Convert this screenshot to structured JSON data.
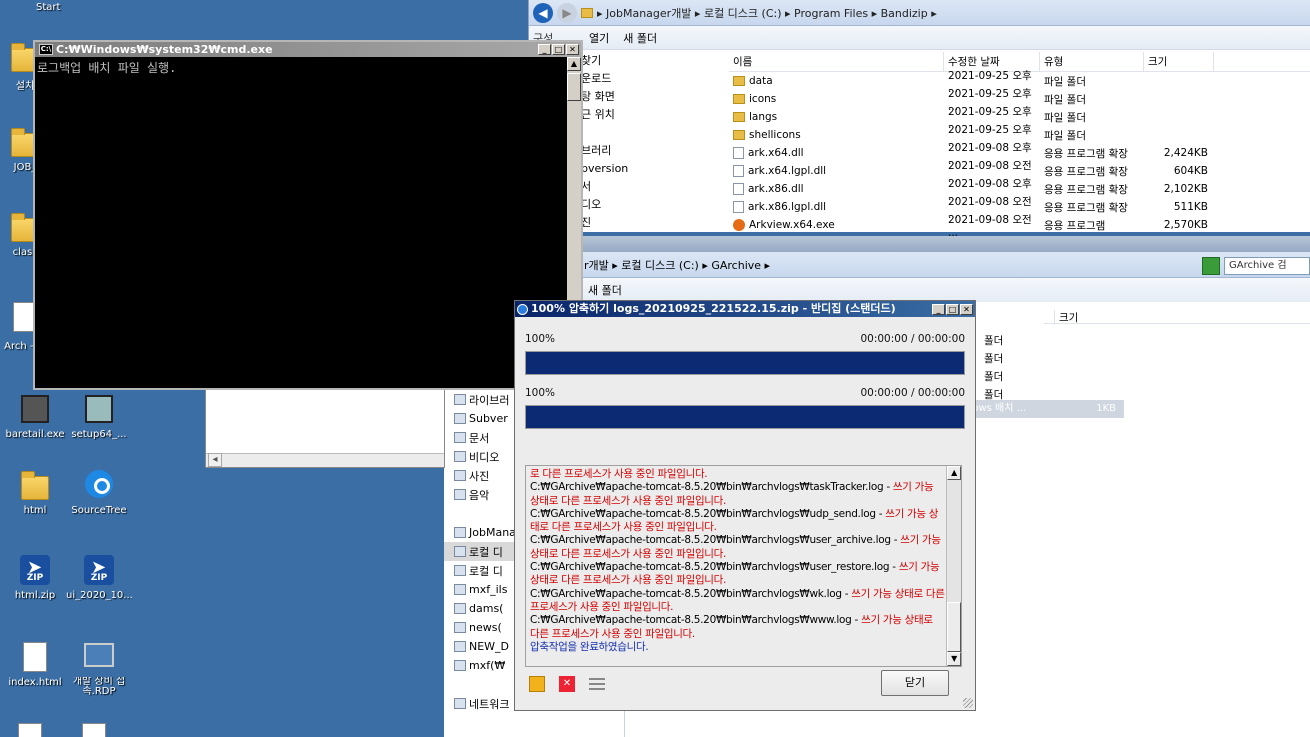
{
  "desktop": {
    "start_label": "Start",
    "icons": [
      {
        "label": "설치"
      },
      {
        "label": "JOB_"
      },
      {
        "label": "class"
      },
      {
        "label": "Arch - 바"
      },
      {
        "label": "baretail.exe"
      },
      {
        "label": "setup64_..."
      },
      {
        "label": "html"
      },
      {
        "label": "SourceTree"
      },
      {
        "label": "html.zip"
      },
      {
        "label": "ui_2020_10..."
      },
      {
        "label": "index.html"
      },
      {
        "label": "개발 장비 접속.RDP"
      }
    ],
    "zip_badge": "ZIP"
  },
  "explorer_top": {
    "breadcrumb": "▸ JobManager개발 ▸ 로컬 디스크 (C:) ▸ Program Files ▸ Bandizip ▸",
    "toolbar": {
      "org": "구성",
      "open": "열기",
      "new_folder": "새 폴더"
    },
    "nav": [
      "찾기",
      "운로드",
      "탕 화면",
      "근 위치",
      "",
      "브러리",
      "bversion",
      "서",
      "디오",
      "진",
      "악"
    ],
    "columns": {
      "name": "이름",
      "date": "수정한 날짜",
      "type": "유형",
      "size": "크기"
    },
    "files": [
      {
        "name": "data",
        "date": "2021-09-25 오후 ...",
        "type": "파일 폴더",
        "size": "",
        "kind": "folder"
      },
      {
        "name": "icons",
        "date": "2021-09-25 오후 ...",
        "type": "파일 폴더",
        "size": "",
        "kind": "folder"
      },
      {
        "name": "langs",
        "date": "2021-09-25 오후 ...",
        "type": "파일 폴더",
        "size": "",
        "kind": "folder"
      },
      {
        "name": "shellicons",
        "date": "2021-09-25 오후 ...",
        "type": "파일 폴더",
        "size": "",
        "kind": "folder"
      },
      {
        "name": "ark.x64.dll",
        "date": "2021-09-08 오후 ...",
        "type": "응용 프로그램 확장",
        "size": "2,424KB",
        "kind": "dll"
      },
      {
        "name": "ark.x64.lgpl.dll",
        "date": "2021-09-08 오전 ...",
        "type": "응용 프로그램 확장",
        "size": "604KB",
        "kind": "dll"
      },
      {
        "name": "ark.x86.dll",
        "date": "2021-09-08 오후 ...",
        "type": "응용 프로그램 확장",
        "size": "2,102KB",
        "kind": "dll"
      },
      {
        "name": "ark.x86.lgpl.dll",
        "date": "2021-09-08 오전 ...",
        "type": "응용 프로그램 확장",
        "size": "511KB",
        "kind": "dll"
      },
      {
        "name": "Arkview.x64.exe",
        "date": "2021-09-08 오전 ...",
        "type": "응용 프로그램",
        "size": "2,570KB",
        "kind": "exe"
      }
    ]
  },
  "explorer_bottom": {
    "breadcrumb": "r개발 ▸ 로컬 디스크 (C:) ▸ GArchive ▸",
    "search_placeholder": "GArchive 검",
    "toolbar_new_folder": "새 폴더",
    "size_col": "크기",
    "rows": [
      "폴더",
      "폴더",
      "폴더",
      "폴더"
    ],
    "selected_row": "dows 배치 ...",
    "selected_size": "1KB"
  },
  "left_pane": {
    "items": [
      {
        "label": "라이브러",
        "sel": false
      },
      {
        "label": "Subver",
        "sel": false
      },
      {
        "label": "문서",
        "sel": false
      },
      {
        "label": "비디오",
        "sel": false
      },
      {
        "label": "사진",
        "sel": false
      },
      {
        "label": "음악",
        "sel": false
      },
      {
        "label": "",
        "sel": false
      },
      {
        "label": "JobMana",
        "sel": false
      },
      {
        "label": "로컬 디",
        "sel": true
      },
      {
        "label": "로컬 디",
        "sel": false
      },
      {
        "label": "mxf_ils",
        "sel": false
      },
      {
        "label": "dams(",
        "sel": false
      },
      {
        "label": "news(",
        "sel": false
      },
      {
        "label": "NEW_D",
        "sel": false
      },
      {
        "label": "mxf(₩",
        "sel": false
      },
      {
        "label": "",
        "sel": false
      },
      {
        "label": "네트워크",
        "sel": false
      }
    ]
  },
  "cmd": {
    "title": "C:₩Windows₩system32₩cmd.exe",
    "icon_text": "C:\\",
    "output": "로그백업 배치 파일 실행."
  },
  "bandizip": {
    "title": "100% 압축하기 logs_20210925_221522.15.zip - 반디집 (스탠더드)",
    "progress1": {
      "label": "100%",
      "time": "00:00:00 / 00:00:00",
      "value": 1.0
    },
    "progress2": {
      "label": "100%",
      "time": "00:00:00 / 00:00:00",
      "value": 1.0
    },
    "log": [
      {
        "path": "",
        "err": "로 다른 프로세스가 사용 중인 파일입니다."
      },
      {
        "path": "C:₩GArchive₩apache-tomcat-8.5.20₩bin₩archvlogs₩taskTracker.log - ",
        "err": "쓰기 가능 상태로 다른 프로세스가 사용 중인 파일입니다."
      },
      {
        "path": "C:₩GArchive₩apache-tomcat-8.5.20₩bin₩archvlogs₩udp_send.log - ",
        "err": "쓰기 가능 상태로 다른 프로세스가 사용 중인 파일입니다."
      },
      {
        "path": "C:₩GArchive₩apache-tomcat-8.5.20₩bin₩archvlogs₩user_archive.log - ",
        "err": "쓰기 가능 상태로 다른 프로세스가 사용 중인 파일입니다."
      },
      {
        "path": "C:₩GArchive₩apache-tomcat-8.5.20₩bin₩archvlogs₩user_restore.log - ",
        "err": "쓰기 가능 상태로 다른 프로세스가 사용 중인 파일입니다."
      },
      {
        "path": "C:₩GArchive₩apache-tomcat-8.5.20₩bin₩archvlogs₩wk.log - ",
        "err": "쓰기 가능 상태로 다른 프로세스가 사용 중인 파일입니다."
      },
      {
        "path": "C:₩GArchive₩apache-tomcat-8.5.20₩bin₩archvlogs₩www.log - ",
        "err": "쓰기 가능 상태로 다른 프로세스가 사용 중인 파일입니다."
      }
    ],
    "done_message": "압축작업을 완료하였습니다.",
    "close_label": "닫기"
  }
}
